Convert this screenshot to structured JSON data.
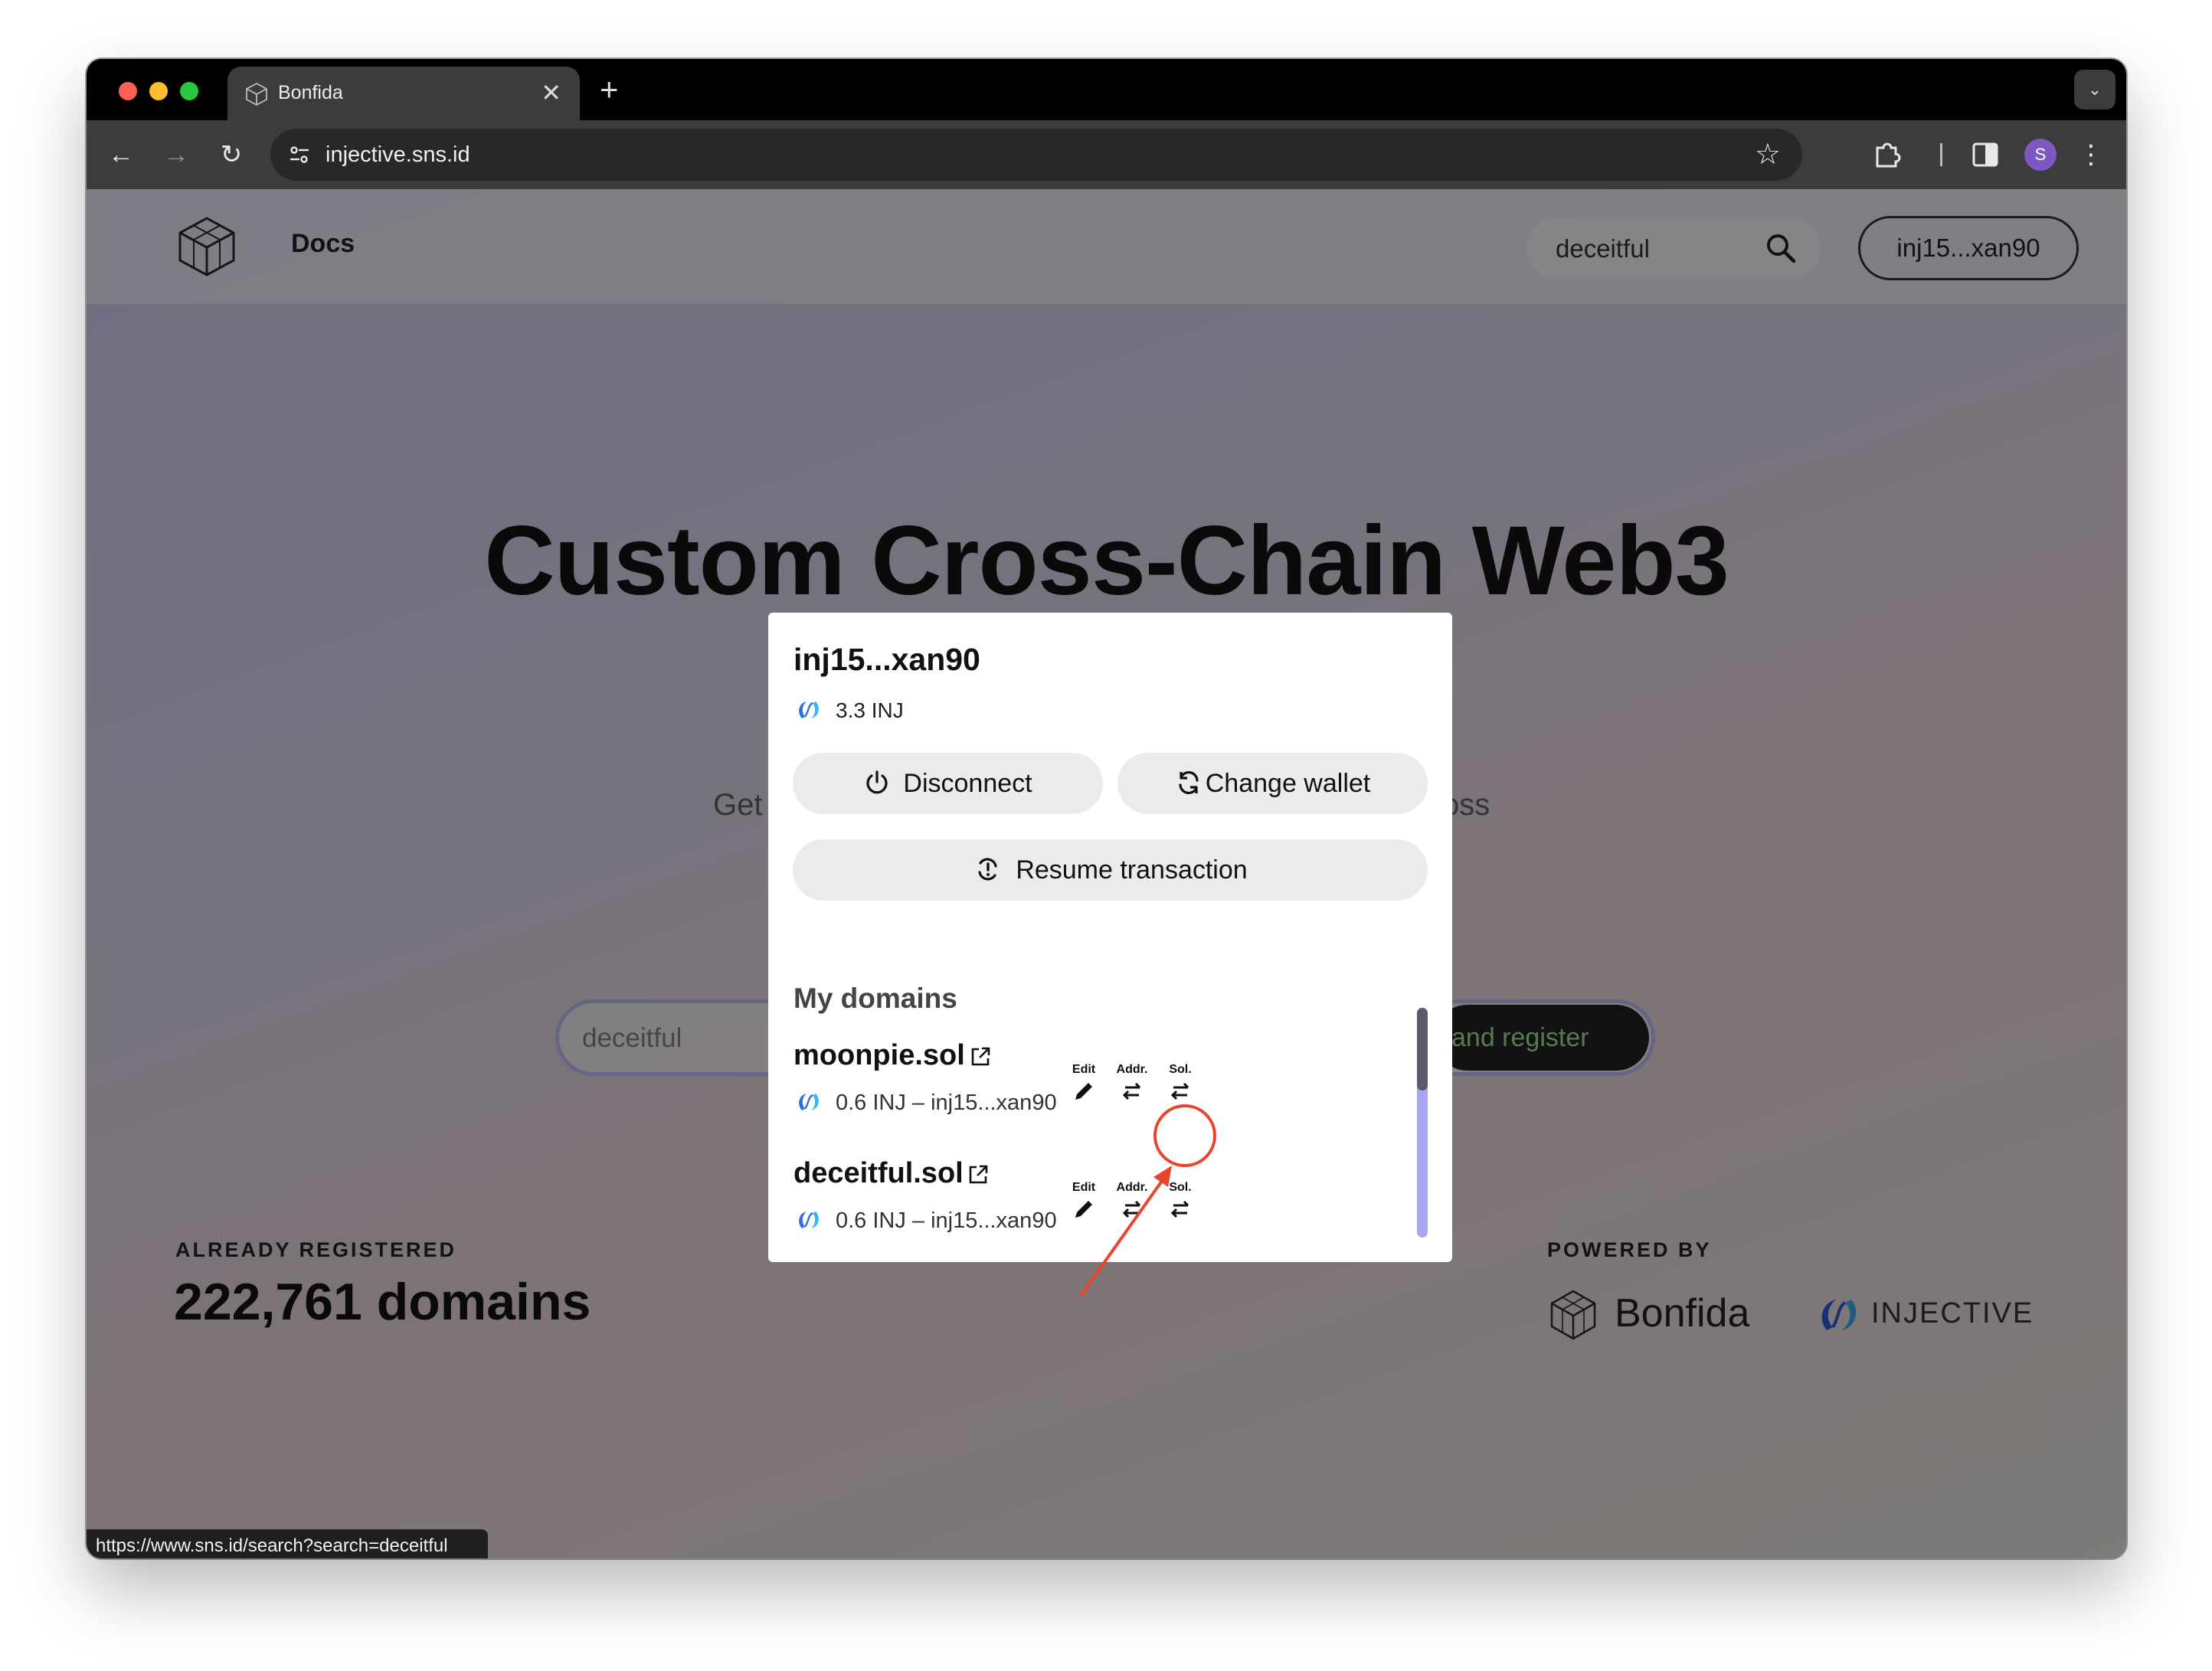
{
  "browser": {
    "tab_title": "Bonfida",
    "url": "injective.sns.id",
    "profile_initial": "S",
    "status_url": "https://www.sns.id/search?search=deceitful"
  },
  "site": {
    "nav_docs": "Docs",
    "search_value": "deceitful",
    "wallet_label": "inj15...xan90",
    "hero_title": "Custom Cross-Chain Web3",
    "hero_sub_left": "Get",
    "hero_sub_right": "oss",
    "hero_search_value": "deceitful",
    "register_label": "and register",
    "stats_label": "ALREADY REGISTERED",
    "stats_count": "222,761 domains",
    "powered_by": "POWERED BY",
    "bonfida": "Bonfida",
    "injective": "INJECTIVE"
  },
  "modal": {
    "address": "inj15...xan90",
    "balance": "3.3 INJ",
    "disconnect": "Disconnect",
    "change_wallet": "Change wallet",
    "resume": "Resume transaction",
    "domains_heading": "My domains",
    "actions": {
      "edit": "Edit",
      "addr": "Addr.",
      "sol": "Sol."
    },
    "domains": [
      {
        "name": "moonpie.sol",
        "meta": "0.6 INJ – inj15...xan90"
      },
      {
        "name": "deceitful.sol",
        "meta": "0.6 INJ – inj15...xan90"
      }
    ]
  },
  "colors": {
    "annotation": "#e8452c",
    "scroll_track": "#a9a5ee",
    "register_text": "#9be38b"
  }
}
